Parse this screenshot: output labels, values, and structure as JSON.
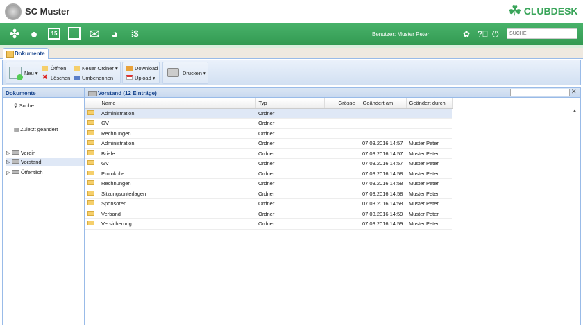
{
  "header": {
    "club_name": "SC Muster",
    "brand": "CLUBDESK"
  },
  "nav": {
    "icons": [
      "clover-icon",
      "user-icon",
      "calendar-icon",
      "documents-icon",
      "mail-icon",
      "globe-icon",
      "finance-icon"
    ],
    "calendar_day": "15",
    "active": "documents-icon",
    "user_label": "Benutzer: Muster Peter",
    "search_placeholder": "SUCHE"
  },
  "tab": {
    "label": "Dokumente"
  },
  "toolbar": {
    "new": "Neu",
    "open": "Öffnen",
    "delete": "Löschen",
    "new_folder": "Neuer Ordner",
    "rename": "Umbenennen",
    "download": "Download",
    "upload": "Upload",
    "print": "Drucken"
  },
  "left": {
    "title": "Dokumente",
    "search": "Suche",
    "recent": "Zuletzt geändert",
    "tree": [
      "Verein",
      "Vorstand",
      "Öffentlich"
    ],
    "selected": "Vorstand"
  },
  "grid": {
    "title": "Vorstand (12 Einträge)",
    "columns": [
      "Name",
      "Typ",
      "Grösse",
      "Geändert am",
      "Geändert durch"
    ],
    "rows": [
      [
        "Administration",
        "Ordner",
        "",
        "",
        ""
      ],
      [
        "GV",
        "Ordner",
        "",
        "",
        ""
      ],
      [
        "Rechnungen",
        "Ordner",
        "",
        "",
        ""
      ],
      [
        "Administration",
        "Ordner",
        "",
        "07.03.2016 14:57",
        "Muster Peter"
      ],
      [
        "Briefe",
        "Ordner",
        "",
        "07.03.2016 14:57",
        "Muster Peter"
      ],
      [
        "GV",
        "Ordner",
        "",
        "07.03.2016 14:57",
        "Muster Peter"
      ],
      [
        "Protokolle",
        "Ordner",
        "",
        "07.03.2016 14:58",
        "Muster Peter"
      ],
      [
        "Rechnungen",
        "Ordner",
        "",
        "07.03.2016 14:58",
        "Muster Peter"
      ],
      [
        "Sitzungsunterlagen",
        "Ordner",
        "",
        "07.03.2016 14:58",
        "Muster Peter"
      ],
      [
        "Sponsoren",
        "Ordner",
        "",
        "07.03.2016 14:58",
        "Muster Peter"
      ],
      [
        "Verband",
        "Ordner",
        "",
        "07.03.2016 14:59",
        "Muster Peter"
      ],
      [
        "Versicherung",
        "Ordner",
        "",
        "07.03.2016 14:59",
        "Muster Peter"
      ]
    ],
    "selected_row": 0
  },
  "colors": {
    "nav_green": "#3aa55a",
    "header_blue": "#15428b"
  }
}
